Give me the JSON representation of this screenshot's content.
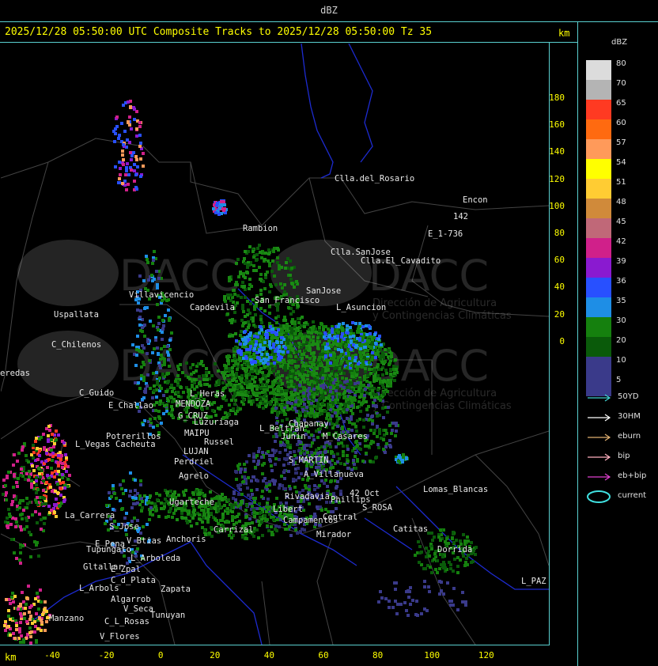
{
  "window_title": "dBZ",
  "header": "2025/12/28 05:50:00 UTC Composite Tracks to 2025/12/28 05:50:00 Tz 35",
  "axis_unit": "km",
  "y_ticks": [
    "180",
    "160",
    "140",
    "120",
    "100",
    "80",
    "60",
    "40",
    "20",
    "0"
  ],
  "x_ticks": [
    "-40",
    "-20",
    "0",
    "20",
    "40",
    "60",
    "80",
    "100",
    "120"
  ],
  "legend": {
    "title": "dBZ",
    "scale": [
      {
        "label": "80",
        "color": "#dcdcdc"
      },
      {
        "label": "70",
        "color": "#b4b4b4"
      },
      {
        "label": "65",
        "color": "#ff3a22"
      },
      {
        "label": "60",
        "color": "#ff6a10"
      },
      {
        "label": "57",
        "color": "#ff9a5a"
      },
      {
        "label": "54",
        "color": "#ffff00"
      },
      {
        "label": "51",
        "color": "#ffcc33"
      },
      {
        "label": "48",
        "color": "#d08a3a"
      },
      {
        "label": "45",
        "color": "#c06878"
      },
      {
        "label": "42",
        "color": "#d0208a"
      },
      {
        "label": "39",
        "color": "#8a1ad0"
      },
      {
        "label": "36",
        "color": "#2850ff"
      },
      {
        "label": "35",
        "color": "#1e8ee6"
      },
      {
        "label": "30",
        "color": "#15800e"
      },
      {
        "label": "20",
        "color": "#0a5a0a"
      },
      {
        "label": "10",
        "color": "#3a3a8a"
      },
      {
        "label": "5",
        "color": "#3a3a8a"
      }
    ],
    "tracks": [
      {
        "label": "50YD",
        "color": "#40d0d0"
      },
      {
        "label": "30HM",
        "color": "#ffffff"
      },
      {
        "label": "eburn",
        "color": "#e0b070"
      },
      {
        "label": "bip",
        "color": "#ffb0c0"
      },
      {
        "label": "eb+bip",
        "color": "#e040d0"
      },
      {
        "label": "current",
        "color": "#40e0e0"
      }
    ]
  },
  "watermark": {
    "brand": "DACC",
    "line1": "Dirección de Agricultura",
    "line2": "y Contingencias Climáticas"
  },
  "places": [
    "Clla.del_Rosario",
    "Encon",
    "142",
    "E_1-736",
    "Rambion",
    "Clla.SanJose",
    "Clla.El_Cavadito",
    "Villavicencio",
    "San_Francisco",
    "SanJose",
    "L_Asuncion",
    "Uspallata",
    "Capdevila",
    "C_Chilenos",
    "L_Heras",
    "C_Guido",
    "MENDOZA",
    "E_Challao",
    "G_CRUZ",
    "Luzuriaga",
    "MAIPU",
    "Russel",
    "Cacheuta",
    "Potrerillos",
    "L_Vegas",
    "LUJAN",
    "Perdriel",
    "Agrelo",
    "L_Beltran",
    "Chapanay",
    "Junin",
    "M_Casares",
    "S_MARTIN",
    "A_Villanueva",
    "Phillips",
    "42_Oct",
    "S_ROSA",
    "Lomas_Blancas",
    "La_Carrera",
    "S_Jose",
    "Tupungato",
    "Ugarteche",
    "Anchoris",
    "Carrizal",
    "Rivadavia",
    "Libert",
    "Campamentos",
    "Central",
    "Catitas",
    "Mirador",
    "Dorrida",
    "E_Pena",
    "V_Btias",
    "L_Arboleda",
    "Gltallar",
    "E_Zpal",
    "C_d_Plata",
    "L_Arbols",
    "Zapata",
    "Algarrob",
    "V_Seca",
    "Tunuyan",
    "Manzano",
    "C_L_Rosas",
    "V_Flores",
    "L_PAZ",
    "eredas"
  ]
}
